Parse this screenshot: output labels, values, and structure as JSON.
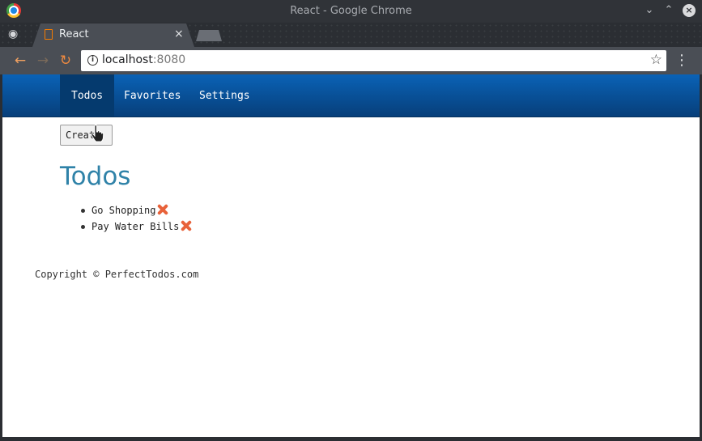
{
  "window": {
    "title": "React - Google Chrome"
  },
  "tab": {
    "title": "React"
  },
  "address_bar": {
    "host": "localhost",
    "port": ":8080"
  },
  "nav": {
    "items": [
      "Todos",
      "Favorites",
      "Settings"
    ],
    "active": "Todos"
  },
  "page": {
    "create_label": "Create",
    "heading": "Todos",
    "todos": [
      "Go Shopping",
      "Pay Water Bills"
    ],
    "footer": "Copyright © PerfectTodos.com"
  },
  "colors": {
    "navbar": "#0a62b6",
    "heading": "#2f82a8",
    "delete": "#e8623a",
    "chrome_accent": "#f57c00"
  }
}
